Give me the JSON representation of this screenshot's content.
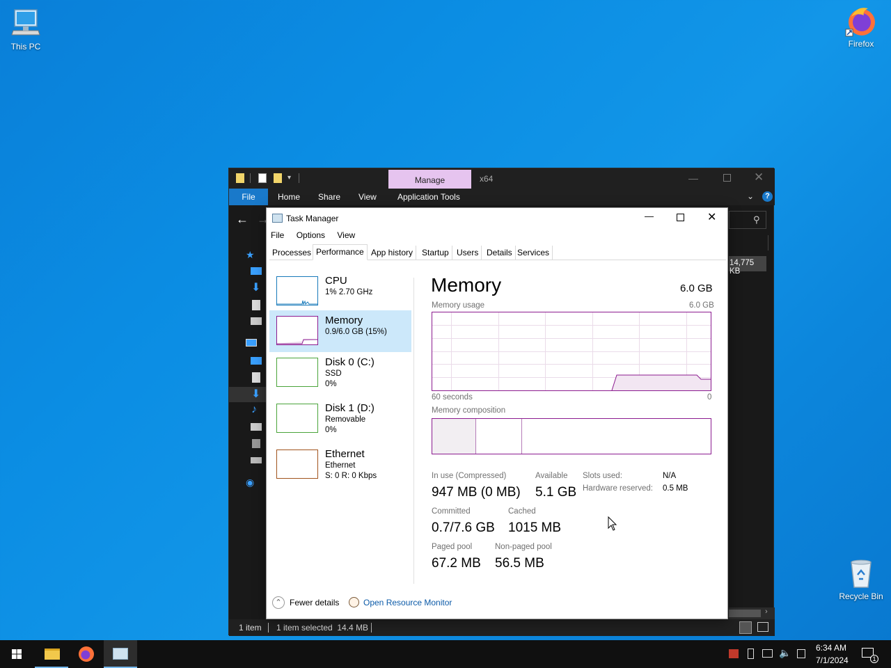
{
  "desktop": {
    "icons": [
      {
        "label": "This PC"
      },
      {
        "label": "Firefox"
      },
      {
        "label": "Recycle Bin"
      }
    ]
  },
  "explorer": {
    "contextual_tab": "Manage",
    "title_suffix": "x64",
    "ribbon_tabs": [
      "File",
      "Home",
      "Share",
      "View",
      "Application Tools"
    ],
    "size_value": "14,775 KB",
    "status_items": "1 item",
    "status_selected": "1 item selected  14.4 MB",
    "accent_color": "#1979ca"
  },
  "taskmanager": {
    "title": "Task Manager",
    "menu": [
      "File",
      "Options",
      "View"
    ],
    "tabs": [
      "Processes",
      "Performance",
      "App history",
      "Startup",
      "Users",
      "Details",
      "Services"
    ],
    "active_tab": "Performance",
    "sidebar": [
      {
        "name": "CPU",
        "line1": "1% 2.70 GHz",
        "line2": "",
        "color": "#1779ba"
      },
      {
        "name": "Memory",
        "line1": "0.9/6.0 GB (15%)",
        "line2": "",
        "color": "#8b1a8f"
      },
      {
        "name": "Disk 0 (C:)",
        "line1": "SSD",
        "line2": "0%",
        "color": "#4aa43a"
      },
      {
        "name": "Disk 1 (D:)",
        "line1": "Removable",
        "line2": "0%",
        "color": "#4aa43a"
      },
      {
        "name": "Ethernet",
        "line1": "Ethernet",
        "line2": "S: 0 R: 0 Kbps",
        "color": "#a0521b"
      }
    ],
    "memory": {
      "heading": "Memory",
      "total": "6.0 GB",
      "usage_label": "Memory usage",
      "usage_max": "6.0 GB",
      "axis_left": "60 seconds",
      "axis_right": "0",
      "composition_label": "Memory composition",
      "in_use_label": "In use (Compressed)",
      "in_use_value": "947 MB (0 MB)",
      "available_label": "Available",
      "available_value": "5.1 GB",
      "committed_label": "Committed",
      "committed_value": "0.7/7.6 GB",
      "cached_label": "Cached",
      "cached_value": "1015 MB",
      "paged_label": "Paged pool",
      "paged_value": "67.2 MB",
      "nonpaged_label": "Non-paged pool",
      "nonpaged_value": "56.5 MB",
      "slots_label": "Slots used:",
      "slots_value": "N/A",
      "hwres_label": "Hardware reserved:",
      "hwres_value": "0.5 MB",
      "line_color": "#8b1a8f"
    },
    "footer": {
      "fewer_details": "Fewer details",
      "resource_monitor": "Open Resource Monitor"
    }
  },
  "taskbar": {
    "time": "6:34 AM",
    "date": "7/1/2024",
    "notification_count": "1"
  }
}
